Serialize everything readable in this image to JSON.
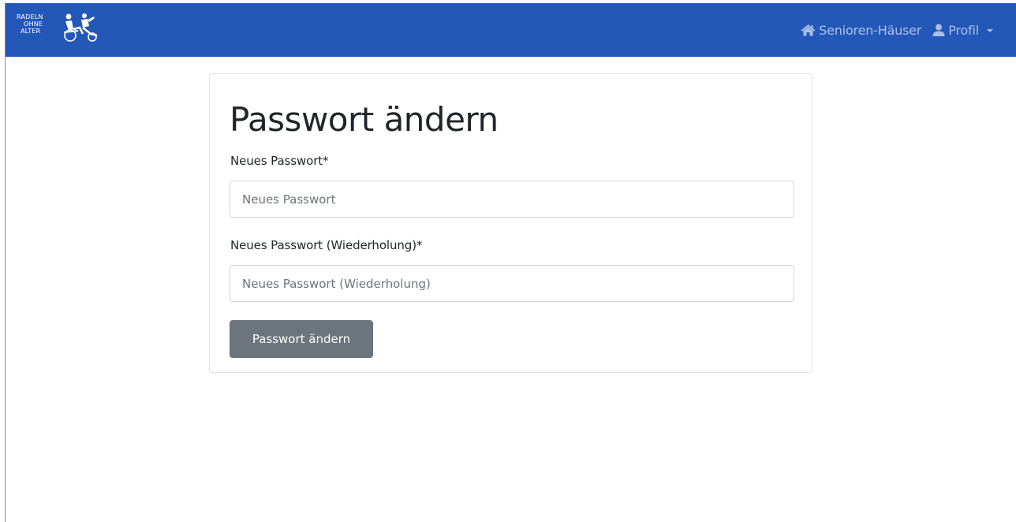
{
  "navbar": {
    "brand_lines": [
      "RADELN",
      "OHNE",
      "ALTER"
    ],
    "brand_icon": "rickshaw-logo",
    "links": [
      {
        "label": "Senioren-Häuser",
        "icon": "home-icon"
      },
      {
        "label": "Profil",
        "icon": "user-icon",
        "dropdown": true
      }
    ],
    "color": "#2458b8"
  },
  "form": {
    "title": "Passwort ändern",
    "fields": [
      {
        "label": "Neues Passwort*",
        "placeholder": "Neues Passwort",
        "value": ""
      },
      {
        "label": "Neues Passwort (Wiederholung)*",
        "placeholder": "Neues Passwort (Wiederholung)",
        "value": ""
      }
    ],
    "submit_label": "Passwort ändern",
    "submit_color": "#6c757d"
  }
}
